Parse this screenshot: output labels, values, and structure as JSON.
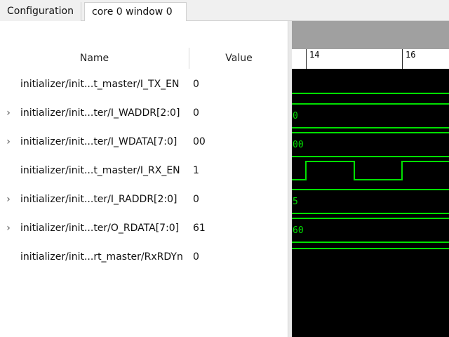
{
  "tabs": [
    {
      "label": "Configuration",
      "active": false
    },
    {
      "label": "core 0 window 0",
      "active": true
    }
  ],
  "columns": {
    "name": "Name",
    "value": "Value"
  },
  "signals": [
    {
      "name": "initializer/init...t_master/I_TX_EN",
      "value": "0",
      "expandable": false
    },
    {
      "name": "initializer/init...ter/I_WADDR[2:0]",
      "value": "0",
      "expandable": true
    },
    {
      "name": "initializer/init...ter/I_WDATA[7:0]",
      "value": "00",
      "expandable": true
    },
    {
      "name": "initializer/init...t_master/I_RX_EN",
      "value": "1",
      "expandable": false
    },
    {
      "name": "initializer/init...ter/I_RADDR[2:0]",
      "value": "0",
      "expandable": true
    },
    {
      "name": "initializer/init...ter/O_RDATA[7:0]",
      "value": "61",
      "expandable": true
    },
    {
      "name": "initializer/init...rt_master/RxRDYn",
      "value": "0",
      "expandable": false
    }
  ],
  "ruler": {
    "labels": [
      "14",
      "16"
    ]
  },
  "waveform": {
    "color": "#00e000",
    "bus_labels": {
      "I_WADDR": "0",
      "I_WDATA": "00",
      "I_RADDR": "5",
      "O_RDATA": "60"
    }
  }
}
